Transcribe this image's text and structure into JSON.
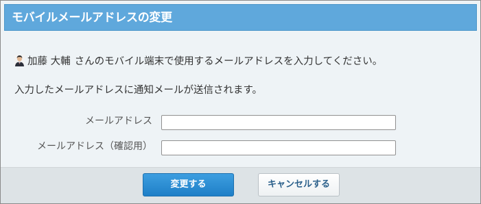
{
  "dialog": {
    "title": "モバイルメールアドレスの変更"
  },
  "user": {
    "name": "加藤 大輔"
  },
  "message": {
    "instruction": "さんのモバイル端末で使用するメールアドレスを入力してください。",
    "notice": "入力したメールアドレスに通知メールが送信されます。"
  },
  "form": {
    "email_label": "メールアドレス",
    "email_value": "",
    "email_confirm_label": "メールアドレス（確認用）",
    "email_confirm_value": ""
  },
  "buttons": {
    "submit_label": "変更する",
    "cancel_label": "キャンセルする"
  },
  "icons": {
    "avatar": "user-avatar-icon"
  },
  "colors": {
    "title_bar": "#5fa8dc",
    "primary_button": "#1e7fc7",
    "background": "#eef3f6",
    "footer": "#dde3e6"
  }
}
